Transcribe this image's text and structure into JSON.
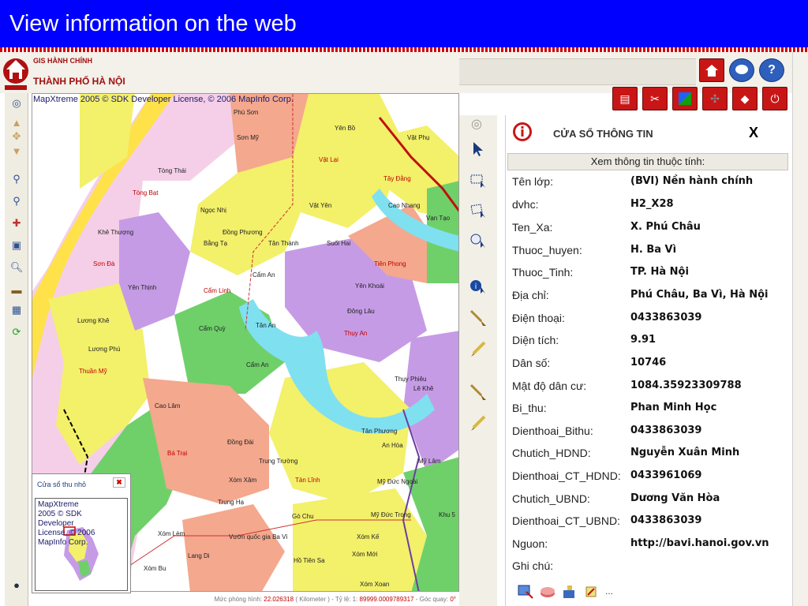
{
  "slide": {
    "title": "View information on the web"
  },
  "app": {
    "subtitle": "GIS HÀNH CHÍNH",
    "title": "THÀNH PHỐ HÀ NỘI"
  },
  "toolbar": {
    "top_icons": [
      "home-icon",
      "chat-icon",
      "help-icon"
    ],
    "bottom_icons": [
      "layers-icon",
      "tools-icon",
      "overlay-icon",
      "grid-icon",
      "map-icon",
      "exit-icon"
    ]
  },
  "left_tools": [
    "pan-up-icon",
    "pan-icon",
    "pan-down-icon",
    "zoom-in-icon",
    "zoom-out-icon",
    "add-point-icon",
    "select-icon",
    "info-icon",
    "measure-icon",
    "print-icon",
    "refresh-icon"
  ],
  "map": {
    "attribution": "MapXtreme 2005 © SDK Developer License, © 2006 MapInfo Corp.",
    "places": [
      "Phú Sơn",
      "Sơn Mỹ",
      "Yên Bồ",
      "Vật Phụ",
      "Vật Lại",
      "Tây Đằng",
      "Tòng Thái",
      "Tòng Bạt",
      "Vật Yên",
      "Cao Nhang",
      "Vạn Tạo",
      "Ngọc Nhị",
      "Đồng Phương",
      "Bằng Tạ",
      "Tân Thành",
      "Suối Hai",
      "Khê Thượng",
      "Sơn Đà",
      "Tiên Phong",
      "Cẩm An",
      "Yên Thịnh",
      "Cẩm Linh",
      "Yên Khoái",
      "Đông Lâu",
      "Lương Khê",
      "Cẩm Quỳ",
      "Tân An",
      "Thụy An",
      "Lương Phú",
      "Thuần Mỹ",
      "Cẩm An",
      "Thụy Phiêu",
      "Lê Khê",
      "Cao Lâm",
      "Đồng Đài",
      "Bá Trại",
      "Tân Phương",
      "An Hòa",
      "Trung Trường",
      "Mỹ Lâm",
      "Xóm Xâm",
      "Tản Lĩnh",
      "Mỹ Đức Ngoài",
      "Trung Hạ",
      "Gò Chu",
      "Mỹ Đức Trong",
      "Khu 5",
      "Xóm Lèm",
      "Vườn quốc gia Ba Vì",
      "Xóm Kế",
      "Lang Di",
      "Xóm Mới",
      "Xóm Bu",
      "Hồ Tiên Sa",
      "Xóm Xoan"
    ]
  },
  "status": {
    "prefix": "Mức phóng hình:",
    "zoom": "22.026318",
    "unit": "( Kilometer )",
    "scale_label": "- Tỷ lệ: 1:",
    "scale": "89999.0009789317",
    "rotation_label": "- Góc quay:",
    "rotation": "0°"
  },
  "overview": {
    "title": "Cửa sổ thu nhỏ",
    "close": "✖",
    "attribution": "MapXtreme 2005 © SDK Developer License, © 2006 MapInfo Corp."
  },
  "mid_tools": [
    "pointer-icon",
    "select-rect-icon",
    "select-poly-icon",
    "zoom-select-icon",
    "info-icon",
    "brush-icon",
    "pencil-icon",
    "brush-icon",
    "pencil-icon"
  ],
  "info": {
    "title": "CỬA SỔ THÔNG TIN",
    "close": "X",
    "subtitle": "Xem thông tin thuộc tính:",
    "rows": [
      {
        "key": "Tên lớp:",
        "value": "(BVI) Nền hành chính"
      },
      {
        "key": "dvhc:",
        "value": "H2_X28"
      },
      {
        "key": "Ten_Xa:",
        "value": "X. Phú Châu"
      },
      {
        "key": "Thuoc_huyen:",
        "value": "H. Ba Vì"
      },
      {
        "key": "Thuoc_Tinh:",
        "value": "TP. Hà Nội"
      },
      {
        "key": "Địa chỉ:",
        "value": "Phú Châu, Ba Vì, Hà Nội"
      },
      {
        "key": "Điện thoại:",
        "value": "0433863039"
      },
      {
        "key": "Diện tích:",
        "value": "9.91"
      },
      {
        "key": "Dân số:",
        "value": "10746"
      },
      {
        "key": "Mật độ dân cư:",
        "value": "1084.35923309788"
      },
      {
        "key": "Bi_thu:",
        "value": "Phan Minh Học"
      },
      {
        "key": "Dienthoai_Bithu:",
        "value": "0433863039"
      },
      {
        "key": "Chutich_HDND:",
        "value": "Nguyễn Xuân Minh"
      },
      {
        "key": "Dienthoai_CT_HDND:",
        "value": "0433961069"
      },
      {
        "key": "Chutich_UBND:",
        "value": "Dương Văn Hòa"
      },
      {
        "key": "Dienthoai_CT_UBND:",
        "value": "0433863039"
      },
      {
        "key": "Nguon:",
        "value": "http://bavi.hanoi.gov.vn"
      },
      {
        "key": "Ghi chú:",
        "value": ""
      }
    ],
    "footer_icons": [
      "export-icon",
      "chart-icon",
      "edit-icon",
      "paint-icon"
    ],
    "more": "..."
  }
}
